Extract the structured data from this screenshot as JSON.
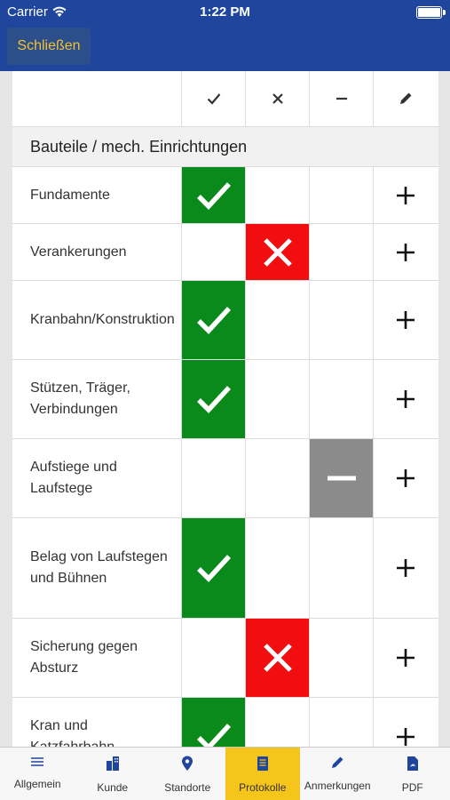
{
  "status_bar": {
    "carrier": "Carrier",
    "time": "1:22 PM"
  },
  "header": {
    "close_label": "Schließen"
  },
  "section_title": "Bauteile / mech. Einrichtungen",
  "columns": [
    {
      "icon": "check-icon"
    },
    {
      "icon": "cross-icon"
    },
    {
      "icon": "minus-icon"
    },
    {
      "icon": "pencil-icon"
    }
  ],
  "rows": [
    {
      "label": "Fundamente",
      "status": "ok"
    },
    {
      "label": "Verankerungen",
      "status": "bad"
    },
    {
      "label": "Kranbahn/Konstruktion",
      "status": "ok"
    },
    {
      "label": "Stützen, Träger, Verbindungen",
      "status": "ok"
    },
    {
      "label": "Aufstiege und Laufstege",
      "status": "neutral"
    },
    {
      "label": "Belag von Laufstegen und Bühnen",
      "status": "ok"
    },
    {
      "label": "Sicherung gegen Absturz",
      "status": "bad"
    },
    {
      "label": "Kran und Katzfahrbahn",
      "status": "ok"
    }
  ],
  "tabs": [
    {
      "label": "Allgemein",
      "icon": "list-icon",
      "active": false
    },
    {
      "label": "Kunde",
      "icon": "building-icon",
      "active": false
    },
    {
      "label": "Standorte",
      "icon": "location-pin-icon",
      "active": false
    },
    {
      "label": "Protokolle",
      "icon": "document-icon",
      "active": true
    },
    {
      "label": "Anmerkungen",
      "icon": "pencil-icon",
      "active": false
    },
    {
      "label": "PDF",
      "icon": "pdf-icon",
      "active": false
    }
  ],
  "colors": {
    "header": "#1f469c",
    "ok": "#0b8a1c",
    "bad": "#f10d10",
    "neutral": "#8b8b8b",
    "active_tab": "#f6c51b"
  }
}
